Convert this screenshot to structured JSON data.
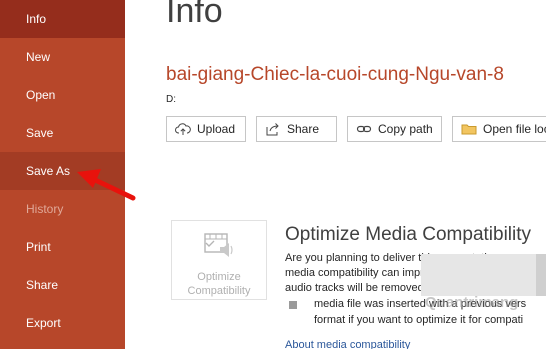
{
  "sidebar": {
    "items": [
      {
        "label": "Info",
        "state": "active"
      },
      {
        "label": "New",
        "state": "normal"
      },
      {
        "label": "Open",
        "state": "normal"
      },
      {
        "label": "Save",
        "state": "normal"
      },
      {
        "label": "Save As",
        "state": "hover"
      },
      {
        "label": "History",
        "state": "disabled"
      },
      {
        "label": "Print",
        "state": "normal"
      },
      {
        "label": "Share",
        "state": "normal"
      },
      {
        "label": "Export",
        "state": "normal"
      }
    ]
  },
  "main": {
    "title": "Info",
    "filename": "bai-giang-Chiec-la-cuoi-cung-Ngu-van-8",
    "path": "D:",
    "buttons": {
      "upload": "Upload",
      "share": "Share",
      "copy_path": "Copy path",
      "open_location": "Open file loc"
    },
    "compat_tile": {
      "line1": "Optimize",
      "line2": "Compatibility"
    },
    "section": {
      "title": "Optimize Media Compatibility",
      "desc_line1": "Are you planning to deliver this presentation on a",
      "desc_line2": "media compatibility can improve your experience",
      "desc_line3": "audio tracks will be removed.",
      "bullet_line1": "media file was inserted with a previous vers",
      "bullet_line2": "format if you want to optimize it for compati",
      "link": "About media compatibility"
    },
    "watermark": "Quantrimang"
  },
  "colors": {
    "sidebar": "#b7472a",
    "sidebar_active": "#952d1c",
    "filename": "#b7472a",
    "arrow": "#e8120c"
  }
}
